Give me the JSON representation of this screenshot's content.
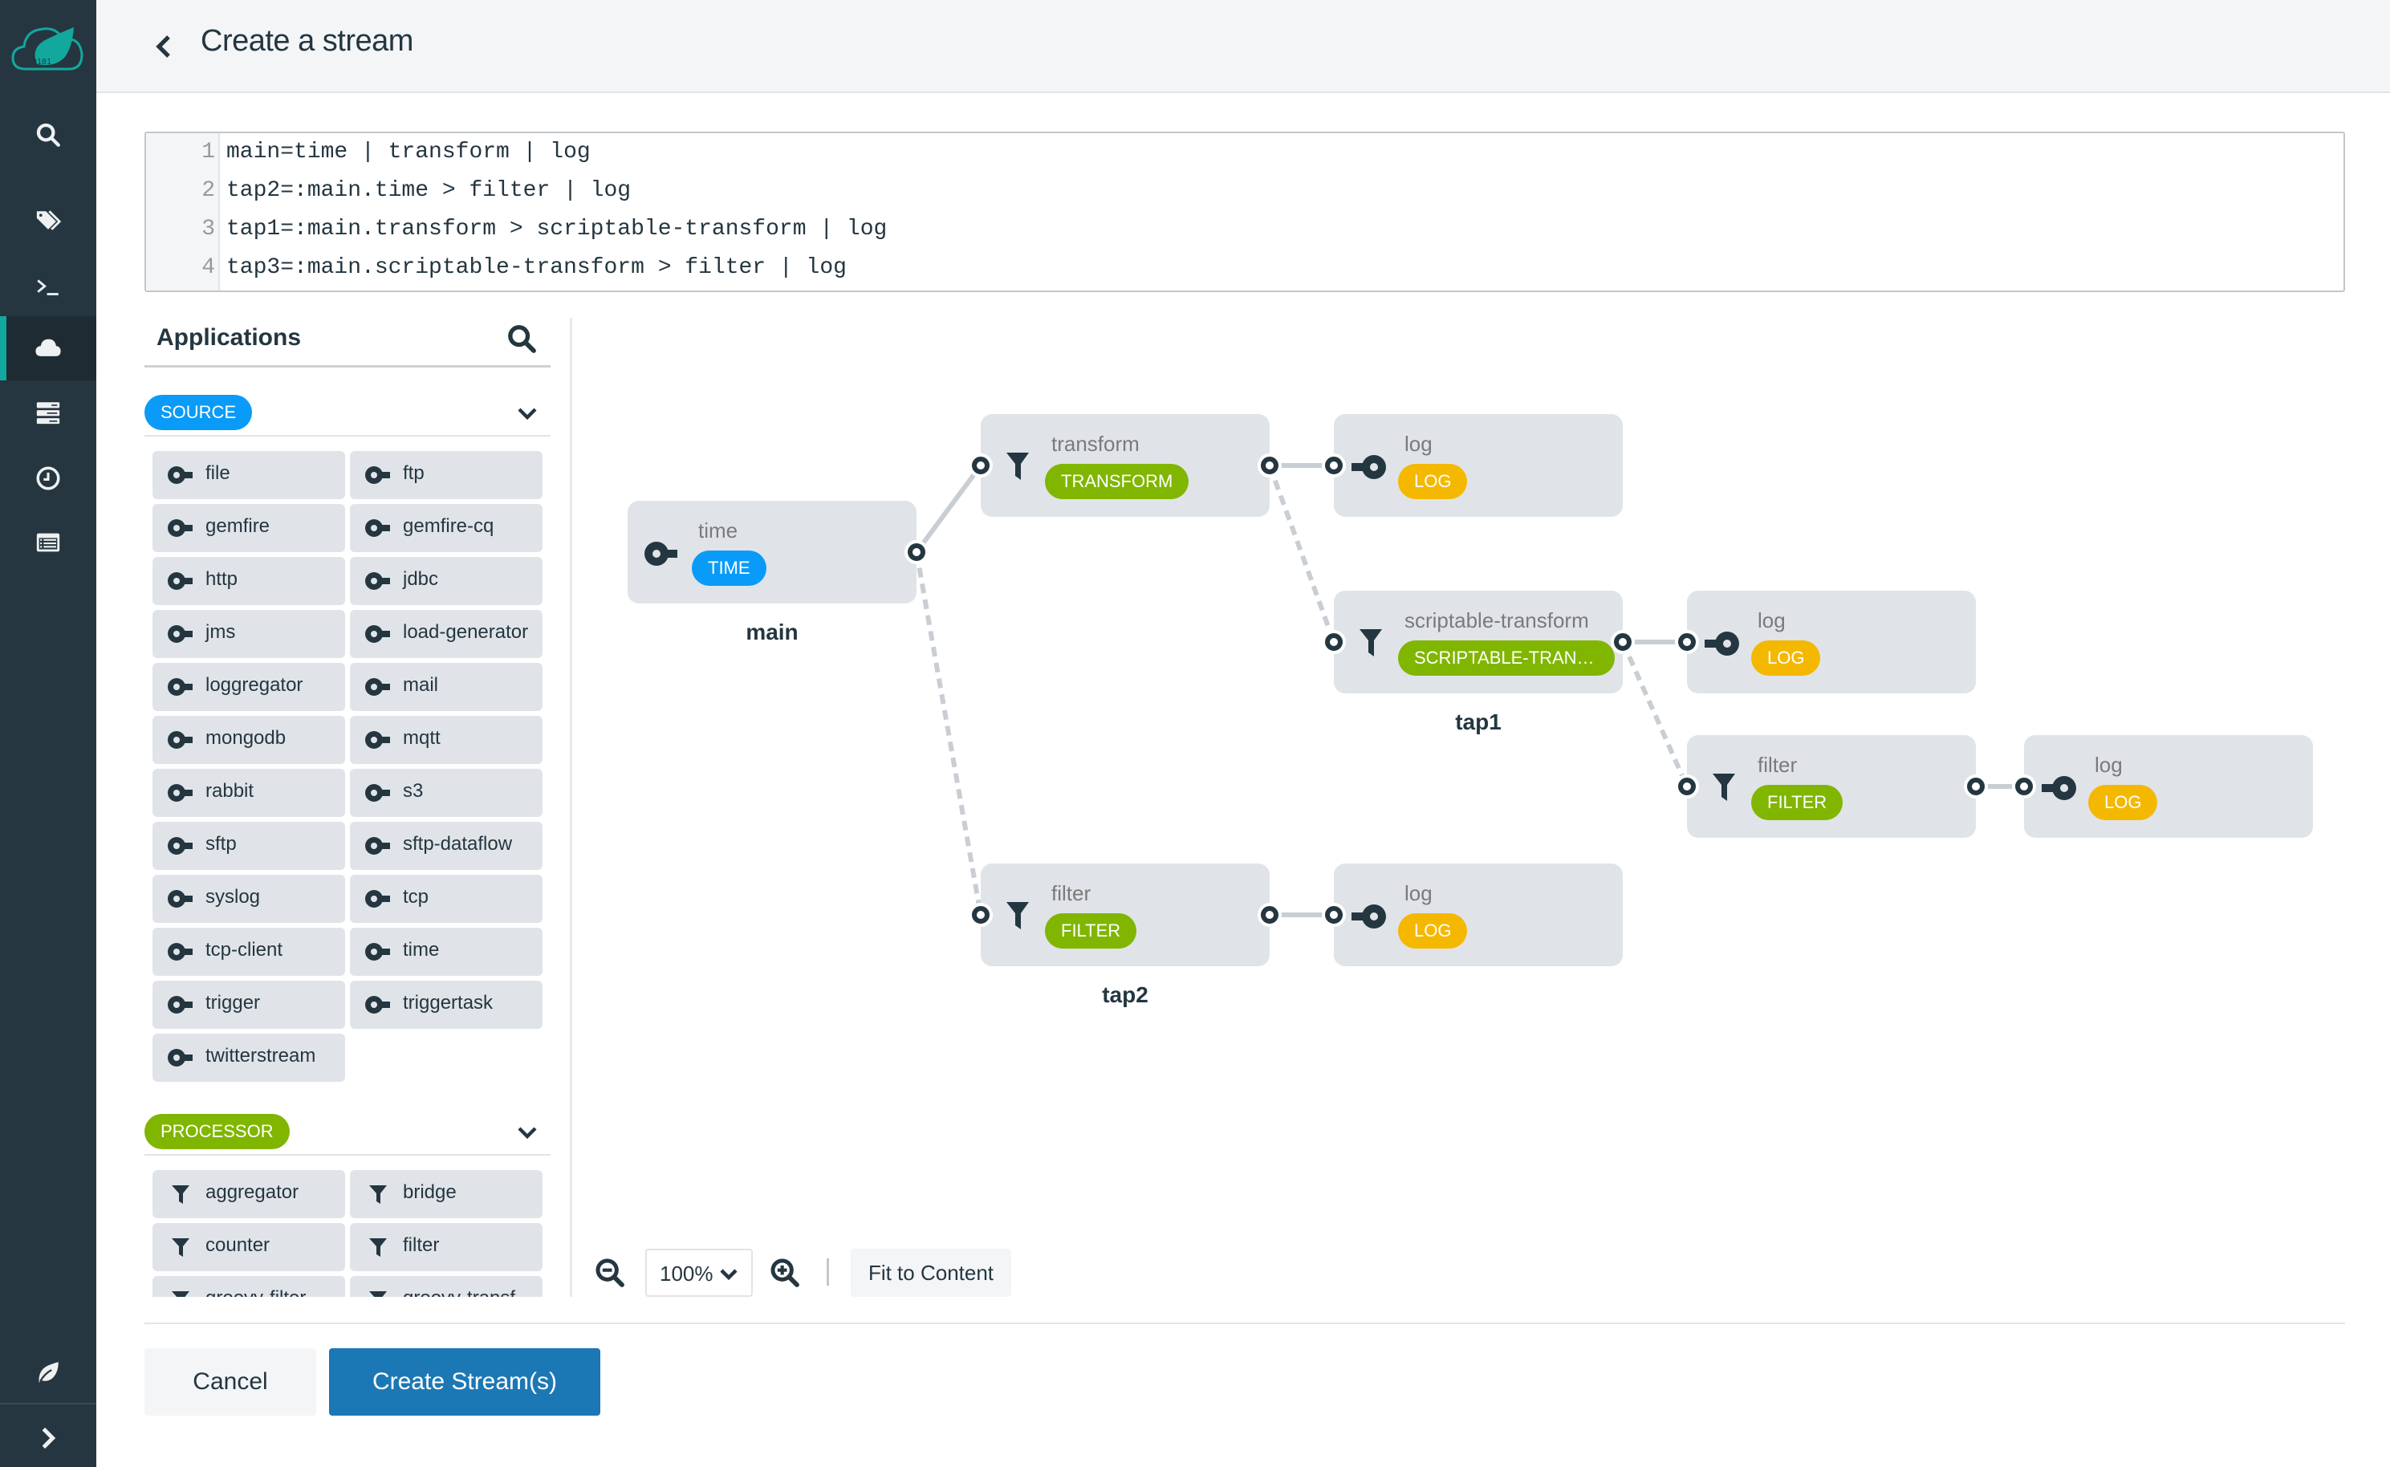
{
  "sidebar": {
    "logo": "spring-cloud-dataflow-logo",
    "items": [
      {
        "name": "search",
        "icon": "search-icon",
        "active": false
      },
      {
        "name": "apps",
        "icon": "tags-icon",
        "active": false
      },
      {
        "name": "shell",
        "icon": "terminal-icon",
        "active": false
      },
      {
        "name": "streams",
        "icon": "cloud-icon",
        "active": true
      },
      {
        "name": "tasks",
        "icon": "server-stack-icon",
        "active": false
      },
      {
        "name": "jobs",
        "icon": "clock-icon",
        "active": false
      },
      {
        "name": "audit",
        "icon": "list-icon",
        "active": false
      }
    ],
    "bottom": [
      {
        "name": "about",
        "icon": "leaf-icon"
      },
      {
        "name": "expand",
        "icon": "chevron-right-icon"
      }
    ]
  },
  "header": {
    "title": "Create a stream",
    "back_icon": "chevron-left-icon"
  },
  "editor": {
    "lines": [
      {
        "no": "1",
        "text": "main=time | transform | log"
      },
      {
        "no": "2",
        "text": "tap2=:main.time > filter | log"
      },
      {
        "no": "3",
        "text": "tap1=:main.transform > scriptable-transform | log"
      },
      {
        "no": "4",
        "text": "tap3=:main.scriptable-transform > filter | log"
      }
    ]
  },
  "palette": {
    "title": "Applications",
    "groups": [
      {
        "label": "SOURCE",
        "color": "#0a9bf8",
        "icon": "source-icon",
        "items": [
          "file",
          "ftp",
          "gemfire",
          "gemfire-cq",
          "http",
          "jdbc",
          "jms",
          "load-generator",
          "loggregator",
          "mail",
          "mongodb",
          "mqtt",
          "rabbit",
          "s3",
          "sftp",
          "sftp-dataflow",
          "syslog",
          "tcp",
          "tcp-client",
          "time",
          "trigger",
          "triggertask",
          "twitterstream"
        ]
      },
      {
        "label": "PROCESSOR",
        "color": "#80b600",
        "icon": "filter-icon",
        "items": [
          "aggregator",
          "bridge",
          "counter",
          "filter",
          "groovy-filter",
          "groovy-transf..."
        ]
      }
    ]
  },
  "graph": {
    "colors": {
      "source": "#0a9bf8",
      "processor": "#80b600",
      "sink": "#f5b800"
    },
    "nodes": [
      {
        "id": "main-time",
        "name": "time",
        "badge": "TIME",
        "type": "source"
      },
      {
        "id": "main-transform",
        "name": "transform",
        "badge": "TRANSFORM",
        "type": "processor"
      },
      {
        "id": "main-log",
        "name": "log",
        "badge": "LOG",
        "type": "sink"
      },
      {
        "id": "tap1-st",
        "name": "scriptable-transform",
        "badge": "SCRIPTABLE-TRANSF...",
        "type": "processor"
      },
      {
        "id": "tap1-log",
        "name": "log",
        "badge": "LOG",
        "type": "sink"
      },
      {
        "id": "tap3-filter",
        "name": "filter",
        "badge": "FILTER",
        "type": "processor"
      },
      {
        "id": "tap3-log",
        "name": "log",
        "badge": "LOG",
        "type": "sink"
      },
      {
        "id": "tap2-filter",
        "name": "filter",
        "badge": "FILTER",
        "type": "processor"
      },
      {
        "id": "tap2-log",
        "name": "log",
        "badge": "LOG",
        "type": "sink"
      }
    ],
    "links": [
      {
        "from": "main-time",
        "to": "main-transform",
        "tap": false
      },
      {
        "from": "main-transform",
        "to": "main-log",
        "tap": false
      },
      {
        "from": "main-time",
        "to": "tap2-filter",
        "tap": true
      },
      {
        "from": "tap2-filter",
        "to": "tap2-log",
        "tap": false
      },
      {
        "from": "main-transform",
        "to": "tap1-st",
        "tap": true
      },
      {
        "from": "tap1-st",
        "to": "tap1-log",
        "tap": false
      },
      {
        "from": "tap1-st",
        "to": "tap3-filter",
        "tap": true
      },
      {
        "from": "tap3-filter",
        "to": "tap3-log",
        "tap": false
      }
    ],
    "stream_labels": [
      "main",
      "tap1",
      "tap2"
    ]
  },
  "zoom": {
    "value": "100%",
    "fit_label": "Fit to Content"
  },
  "actions": {
    "cancel": "Cancel",
    "create": "Create Stream(s)"
  }
}
